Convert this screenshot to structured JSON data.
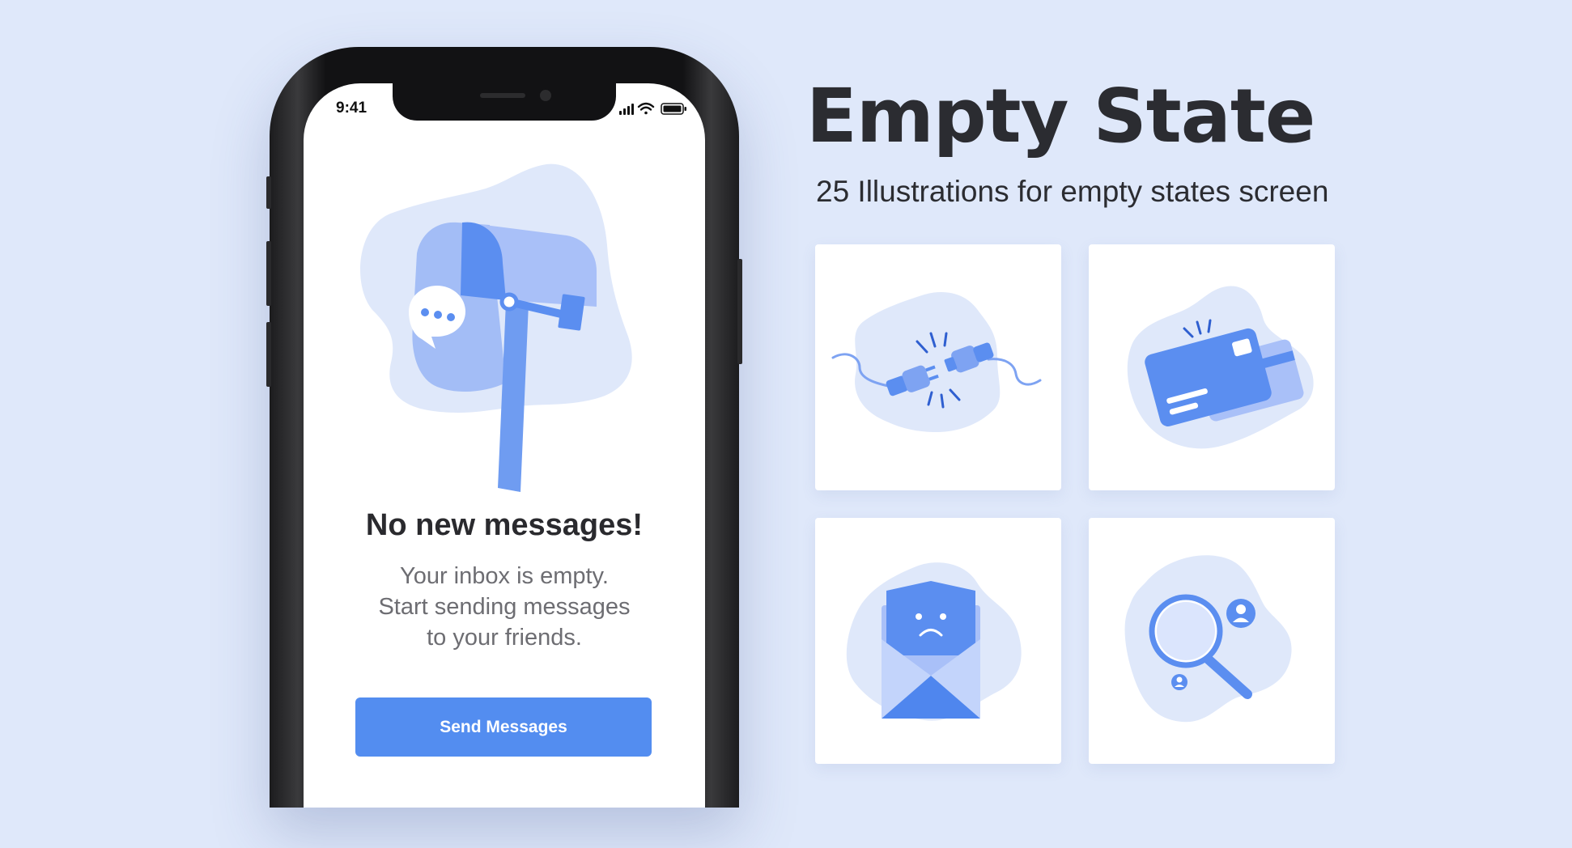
{
  "phone": {
    "status_time": "9:41",
    "empty_title": "No new messages!",
    "empty_desc": [
      "Your inbox is empty.",
      "Start sending messages",
      "to your friends."
    ],
    "button_label": "Send Messages"
  },
  "promo": {
    "title": "Empty State",
    "subtitle": "25 Illustrations for empty states screen"
  },
  "icons": {
    "mailbox": "mailbox-illustration",
    "card1": "unplugged-connector-illustration",
    "card2": "credit-card-illustration",
    "card3": "sad-envelope-illustration",
    "card4": "search-users-illustration"
  },
  "colors": {
    "background": "#dfe8fa",
    "accent": "#538df0",
    "blob": "#dfe8fa",
    "dark_text": "#2b2c31"
  }
}
